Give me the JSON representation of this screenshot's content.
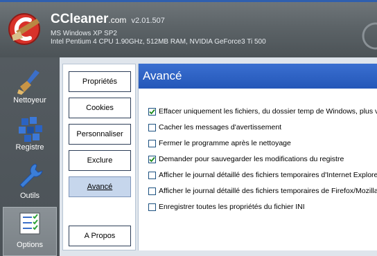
{
  "header": {
    "app_name": "CCleaner",
    "app_domain": ".com",
    "version": "v2.01.507",
    "os": "MS Windows XP SP2",
    "hardware": "Intel Pentium 4 CPU 1.90GHz, 512MB RAM, NVIDIA GeForce3 Ti 500",
    "logo_icon": "ccleaner-logo-icon"
  },
  "nav": {
    "items": [
      {
        "label": "Nettoyeur",
        "icon": "broom-icon"
      },
      {
        "label": "Registre",
        "icon": "registry-cubes-icon"
      },
      {
        "label": "Outils",
        "icon": "wrench-icon"
      },
      {
        "label": "Options",
        "icon": "checklist-icon",
        "active": true
      }
    ]
  },
  "tabs": [
    {
      "label": "Propriétés"
    },
    {
      "label": "Cookies"
    },
    {
      "label": "Personnaliser"
    },
    {
      "label": "Exclure"
    },
    {
      "label": "Avancé",
      "active": true
    },
    {
      "label": "A Propos"
    }
  ],
  "panel": {
    "title": "Avancé",
    "options": [
      {
        "label": "Effacer uniquement les fichiers, du dossier temp de Windows, plus vieux",
        "checked": true
      },
      {
        "label": "Cacher les messages d'avertissement",
        "checked": false
      },
      {
        "label": "Fermer le programme après le nettoyage",
        "checked": false
      },
      {
        "label": "Demander pour sauvegarder les modifications du registre",
        "checked": true
      },
      {
        "label": "Afficher le journal détaillé des fichiers temporaires d'Internet Explorer",
        "checked": false
      },
      {
        "label": "Afficher le journal détaillé des fichiers temporaires de Firefox/Mozilla",
        "checked": false
      },
      {
        "label": "Enregistrer toutes les propriétés du fichier INI",
        "checked": false
      }
    ]
  },
  "colors": {
    "header_bg": "#5c6367",
    "accent_blue": "#2457b8",
    "active_tab": "#c6d6ec"
  }
}
